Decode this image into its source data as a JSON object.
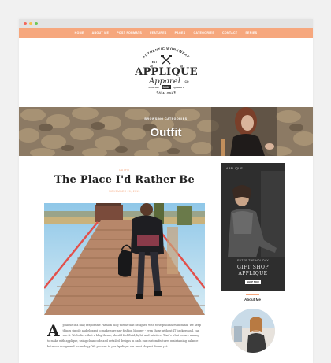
{
  "window_controls": [
    {
      "name": "close",
      "color": "#f2675b"
    },
    {
      "name": "minimize",
      "color": "#f5c04a"
    },
    {
      "name": "maximize",
      "color": "#6fc657"
    }
  ],
  "nav": {
    "items": [
      "HOME",
      "ABOUT ME",
      "POST FORMATS",
      "FEATURES",
      "PAGES",
      "CATEGORIES",
      "CONTACT",
      "SERIES"
    ],
    "background": "#f6a77d"
  },
  "logo": {
    "arc_top": "AUTHENTIC WORKWEAR",
    "est": "EST",
    "year_left": "20",
    "year_right": "15",
    "word1": "APPLIQUE",
    "word2": "Apparel",
    "suffix": "CO",
    "badge": "SHOP",
    "side_left": "CUSTOM",
    "side_right": "QUALITY",
    "arc_bottom": "CATALOGUE"
  },
  "hero": {
    "subtitle": "BROWSING CATEGORIES",
    "title": "Outfit"
  },
  "post": {
    "category": "OUTFIT",
    "title": "The Place I'd Rather Be",
    "date": "NOVEMBER 20, 2015",
    "dropcap": "A",
    "body": "pplique is a fully responsive Fashion blog theme that designed with style publishers in mind! We keep things simple and elegant to make sure any fashion blogger - even those without IT background, can use it. We believe that a blog theme, should feel fluid, light, and intuitive. That's what we are aiming to make with applique, using clean code and detailed designs in each our custom features maintaining balance between design and technology. We present to you Applique our most elegant theme yet."
  },
  "sidebar": {
    "ad": {
      "brand": "APPLIQUE",
      "tagline": "ENTER THE HOLIDAY",
      "line1": "GIFT SHOP",
      "line2": "APPLIQUE",
      "button": "SHOP NOW"
    },
    "about_title": "About Me"
  },
  "accent_color": "#f6a77d"
}
